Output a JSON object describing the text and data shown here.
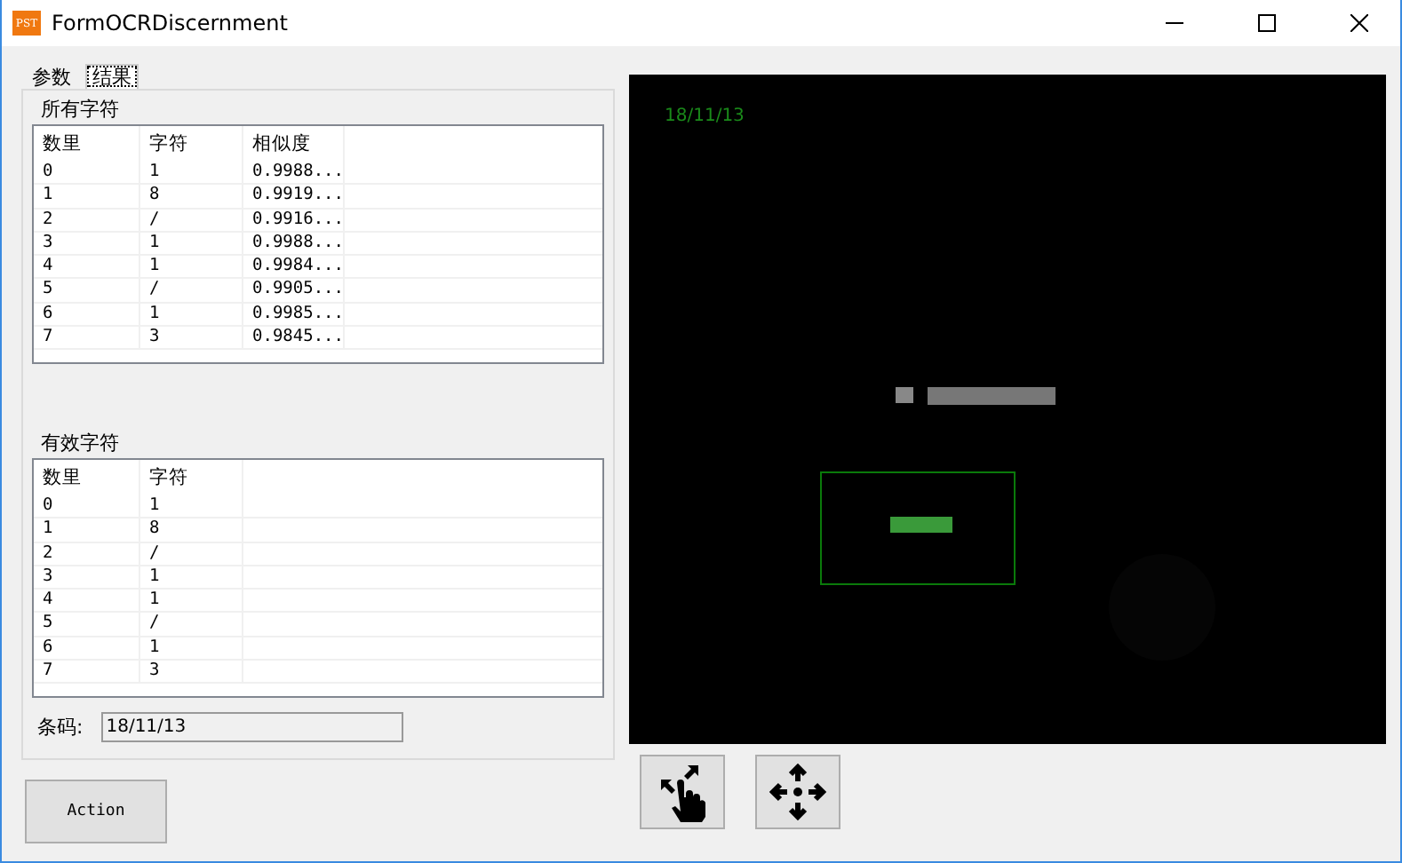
{
  "window": {
    "title": "FormOCRDiscernment",
    "icon_text": "PST"
  },
  "tabs": [
    {
      "label": "参数",
      "selected": false
    },
    {
      "label": "结果",
      "selected": true
    }
  ],
  "all_chars": {
    "title": "所有字符",
    "columns": [
      "数里",
      "字符",
      "相似度"
    ],
    "rows": [
      [
        "0",
        "1",
        "0.9988..."
      ],
      [
        "1",
        "8",
        "0.9919..."
      ],
      [
        "2",
        "/",
        "0.9916..."
      ],
      [
        "3",
        "1",
        "0.9988..."
      ],
      [
        "4",
        "1",
        "0.9984..."
      ],
      [
        "5",
        "/",
        "0.9905..."
      ],
      [
        "6",
        "1",
        "0.9985..."
      ],
      [
        "7",
        "3",
        "0.9845..."
      ]
    ]
  },
  "valid_chars": {
    "title": "有效字符",
    "columns": [
      "数里",
      "字符"
    ],
    "rows": [
      [
        "0",
        "1"
      ],
      [
        "1",
        "8"
      ],
      [
        "2",
        "/"
      ],
      [
        "3",
        "1"
      ],
      [
        "4",
        "1"
      ],
      [
        "5",
        "/"
      ],
      [
        "6",
        "1"
      ],
      [
        "7",
        "3"
      ]
    ]
  },
  "barcode": {
    "label": "条码:",
    "value": "18/11/13"
  },
  "action_button": "Action",
  "viewer": {
    "overlay_text": "18/11/13",
    "kind": "picture"
  }
}
